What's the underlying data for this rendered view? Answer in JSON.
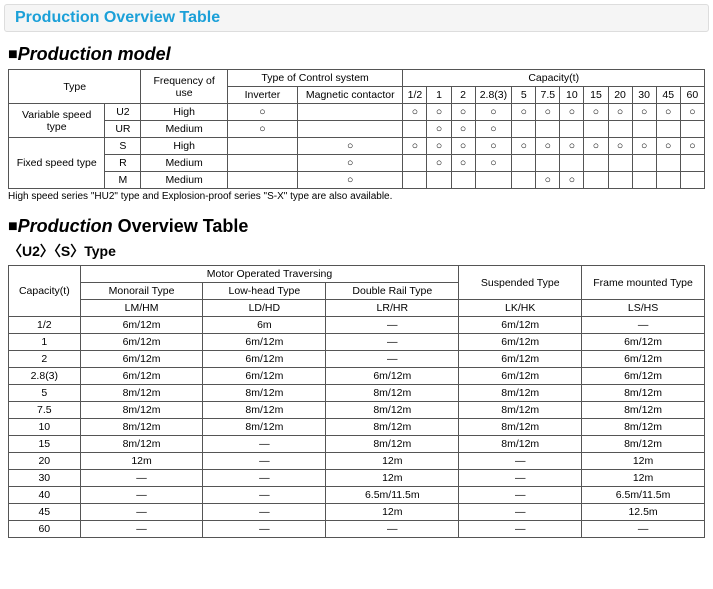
{
  "title_bar": "Production Overview Table",
  "heading1_square": "■",
  "heading1": "Production model",
  "table1": {
    "h_type": "Type",
    "h_freq": "Frequency of use",
    "h_control": "Type of Control system",
    "h_cap": "Capacity(t)",
    "h_inv": "Inverter",
    "h_mag": "Magnetic contactor",
    "caps": [
      "1/2",
      "1",
      "2",
      "2.8(3)",
      "5",
      "7.5",
      "10",
      "15",
      "20",
      "30",
      "45",
      "60"
    ],
    "rows": [
      {
        "group": "Variable speed type",
        "type": "U2",
        "freq": "High",
        "inv": "○",
        "mag": "",
        "c": [
          "○",
          "○",
          "○",
          "○",
          "○",
          "○",
          "○",
          "○",
          "○",
          "○",
          "○",
          "○"
        ]
      },
      {
        "group": "",
        "type": "UR",
        "freq": "Medium",
        "inv": "○",
        "mag": "",
        "c": [
          "",
          "○",
          "○",
          "○",
          "",
          "",
          "",
          "",
          "",
          "",
          "",
          ""
        ]
      },
      {
        "group": "Fixed speed type",
        "type": "S",
        "freq": "High",
        "inv": "",
        "mag": "○",
        "c": [
          "○",
          "○",
          "○",
          "○",
          "○",
          "○",
          "○",
          "○",
          "○",
          "○",
          "○",
          "○"
        ]
      },
      {
        "group": "",
        "type": "R",
        "freq": "Medium",
        "inv": "",
        "mag": "○",
        "c": [
          "",
          "○",
          "○",
          "○",
          "",
          "",
          "",
          "",
          "",
          "",
          "",
          ""
        ]
      },
      {
        "group": "",
        "type": "M",
        "freq": "Medium",
        "inv": "",
        "mag": "○",
        "c": [
          "",
          "",
          "",
          "",
          "",
          "○",
          "○",
          "",
          "",
          "",
          "",
          ""
        ]
      }
    ],
    "group1rowspan": 2,
    "group2rowspan": 3
  },
  "footnote": "High speed series \"HU2\" type and Explosion-proof series \"S-X\" type are also available.",
  "heading2_square": "■",
  "heading2_italic": "Production ",
  "heading2_rest": "Overview Table",
  "subheading": "〈U2〉〈S〉Type",
  "table2": {
    "h_cap": "Capacity(t)",
    "h_motor": "Motor Operated Traversing",
    "h_mono": "Monorail Type",
    "h_low": "Low-head Type",
    "h_double": "Double Rail Type",
    "h_susp": "Suspended Type",
    "h_frame": "Frame mounted Type",
    "sub": [
      "LM/HM",
      "LD/HD",
      "LR/HR",
      "LK/HK",
      "LS/HS"
    ],
    "rows": [
      {
        "cap": "1/2",
        "v": [
          "6m/12m",
          "6m",
          "—",
          "6m/12m",
          "—"
        ]
      },
      {
        "cap": "1",
        "v": [
          "6m/12m",
          "6m/12m",
          "—",
          "6m/12m",
          "6m/12m"
        ]
      },
      {
        "cap": "2",
        "v": [
          "6m/12m",
          "6m/12m",
          "—",
          "6m/12m",
          "6m/12m"
        ]
      },
      {
        "cap": "2.8(3)",
        "v": [
          "6m/12m",
          "6m/12m",
          "6m/12m",
          "6m/12m",
          "6m/12m"
        ]
      },
      {
        "cap": "5",
        "v": [
          "8m/12m",
          "8m/12m",
          "8m/12m",
          "8m/12m",
          "8m/12m"
        ]
      },
      {
        "cap": "7.5",
        "v": [
          "8m/12m",
          "8m/12m",
          "8m/12m",
          "8m/12m",
          "8m/12m"
        ]
      },
      {
        "cap": "10",
        "v": [
          "8m/12m",
          "8m/12m",
          "8m/12m",
          "8m/12m",
          "8m/12m"
        ]
      },
      {
        "cap": "15",
        "v": [
          "8m/12m",
          "—",
          "8m/12m",
          "8m/12m",
          "8m/12m"
        ]
      },
      {
        "cap": "20",
        "v": [
          "12m",
          "—",
          "12m",
          "—",
          "12m"
        ]
      },
      {
        "cap": "30",
        "v": [
          "—",
          "—",
          "12m",
          "—",
          "12m"
        ]
      },
      {
        "cap": "40",
        "v": [
          "—",
          "—",
          "6.5m/11.5m",
          "—",
          "6.5m/11.5m"
        ]
      },
      {
        "cap": "45",
        "v": [
          "—",
          "—",
          "12m",
          "—",
          "12.5m"
        ]
      },
      {
        "cap": "60",
        "v": [
          "—",
          "—",
          "—",
          "—",
          "—"
        ]
      }
    ]
  }
}
